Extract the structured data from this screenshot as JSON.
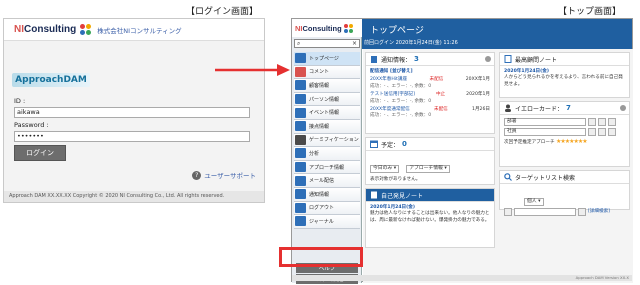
{
  "captions": {
    "login": "【ログイン画面】",
    "top": "【トップ画面】"
  },
  "login": {
    "brand": "Consulting",
    "brand_prefix": "NI",
    "company": "株式会社NIコンサルティング",
    "app_logo": "ApproachDAM",
    "id_label": "ID :",
    "id_value": "aikawa",
    "password_label": "Password :",
    "password_value": "•••••••",
    "login_button": "ログイン",
    "support_link": "ユーザーサポート",
    "footer": "Approach DAM XX.XX.XX Copyright © 2020 NI Consulting Co., Ltd. All rights reserved."
  },
  "top": {
    "brand": "Consulting",
    "brand_prefix": "NI",
    "title": "トップページ",
    "last_login": "前回ログイン 2020年1月24日(金) 11:26",
    "search_placeholder": "",
    "nav": [
      {
        "label": "トップページ",
        "color": "#2e6fb8"
      },
      {
        "label": "コメント",
        "color": "#d9534f"
      },
      {
        "label": "顧客情報",
        "color": "#2e6fb8"
      },
      {
        "label": "パーソン情報",
        "color": "#2e6fb8"
      },
      {
        "label": "イベント情報",
        "color": "#2e6fb8"
      },
      {
        "label": "接点情報",
        "color": "#2e6fb8"
      },
      {
        "label": "ゲーミフィケーション",
        "color": "#4a4a4a"
      },
      {
        "label": "分析",
        "color": "#2e6fb8"
      },
      {
        "label": "アプローチ情報",
        "color": "#2e6fb8"
      },
      {
        "label": "メール配信",
        "color": "#2e6fb8"
      },
      {
        "label": "通知情報",
        "color": "#2e6fb8"
      },
      {
        "label": "ログアウト",
        "color": "#2e6fb8"
      },
      {
        "label": "ジャーナル",
        "color": "#2e6fb8"
      }
    ],
    "help_button": "ヘルプ",
    "system_button": "システム設定",
    "notify": {
      "title": "通知情報：",
      "count": "3",
      "tab": "配信通知 [並び替え]",
      "rows": [
        {
          "name": "20XX年春Hit講座",
          "status": "未配信",
          "date": "20XX年1月",
          "meta": "成功：- 、エラー：-, 余数：0"
        },
        {
          "name": "テスト送信用[宇部記]",
          "status": "中止",
          "date": "2020年1月",
          "meta": "成功：- 、エラー：-, 余数：0"
        },
        {
          "name": "20XX年度通常配信",
          "status": "未配信",
          "date": "1月26日",
          "meta": "成功：- 、エラー：-, 余数：0"
        }
      ]
    },
    "schedule": {
      "title": "予定：",
      "count": "0",
      "sel1": "今日のみ",
      "sel2": "アプローチ情報",
      "empty": "表示対象がありません。"
    },
    "note": {
      "title": "自己発見ノート",
      "date": "2020年1月24日(金)",
      "text": "魅力は他人なりにすることは出来ない。他人なりの魅力とは、周に最新なければ動けない。爆発掛力の魅力である。"
    },
    "kaizen": {
      "title": "最高顧問ノート",
      "date": "2020年1月24日(金)",
      "text": "人からどう見られるかを考えるより、言われる前に自己発見せよ。"
    },
    "yellow": {
      "title": "イエローカード：",
      "count": "7",
      "field1": "部署",
      "field2": "社員",
      "approach_label": "次回予定推定アプローチ",
      "stars": "★★★★★★★"
    },
    "target": {
      "title": "ターゲットリスト検索",
      "select": "個人",
      "link": "[詳細検索]"
    },
    "footer": "Approach DAM Version XX.X"
  }
}
